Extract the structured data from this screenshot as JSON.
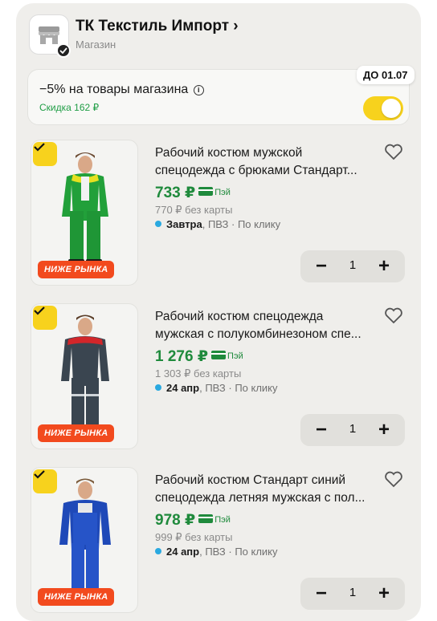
{
  "shop": {
    "name": "ТК Текстиль Импорт",
    "chevron": "›",
    "subtitle": "Магазин",
    "logo_icon": "store-icon",
    "badge_icon": "verified-check-icon"
  },
  "promo": {
    "title": "−5% на товары магазина",
    "info_glyph": "i",
    "discount": "Скидка 162 ₽",
    "date_badge": "ДО 01.07",
    "toggle_on": true,
    "accent": "#f7d21d"
  },
  "badge_text": "НИЖЕ РЫНКА",
  "pay_label": "Пэй",
  "products": [
    {
      "title_line1": "Рабочий костюм мужской",
      "title_line2": "спецодежда с брюками Стандарт...",
      "price": "733 ₽",
      "old_price": "770 ₽ без карты",
      "delivery_day": "Завтра",
      "delivery_rest": ", ПВЗ · По клику",
      "qty": "1"
    },
    {
      "title_line1": "Рабочий костюм спецодежда",
      "title_line2": "мужская с полукомбинезоном спе...",
      "price": "1 276 ₽",
      "old_price": "1 303 ₽ без карты",
      "delivery_day": "24 апр",
      "delivery_rest": ", ПВЗ · По клику",
      "qty": "1"
    },
    {
      "title_line1": "Рабочий костюм Стандарт синий",
      "title_line2": "спецодежда летняя мужская с пол...",
      "price": "978 ₽",
      "old_price": "999 ₽ без карты",
      "delivery_day": "24 апр",
      "delivery_rest": ", ПВЗ · По клику",
      "qty": "1"
    }
  ],
  "stepper": {
    "minus": "−",
    "plus": "+"
  },
  "colors": {
    "price_green": "#1f8a3c",
    "badge_orange": "#f24a1e",
    "delivery_dot": "#2aa9e0"
  }
}
